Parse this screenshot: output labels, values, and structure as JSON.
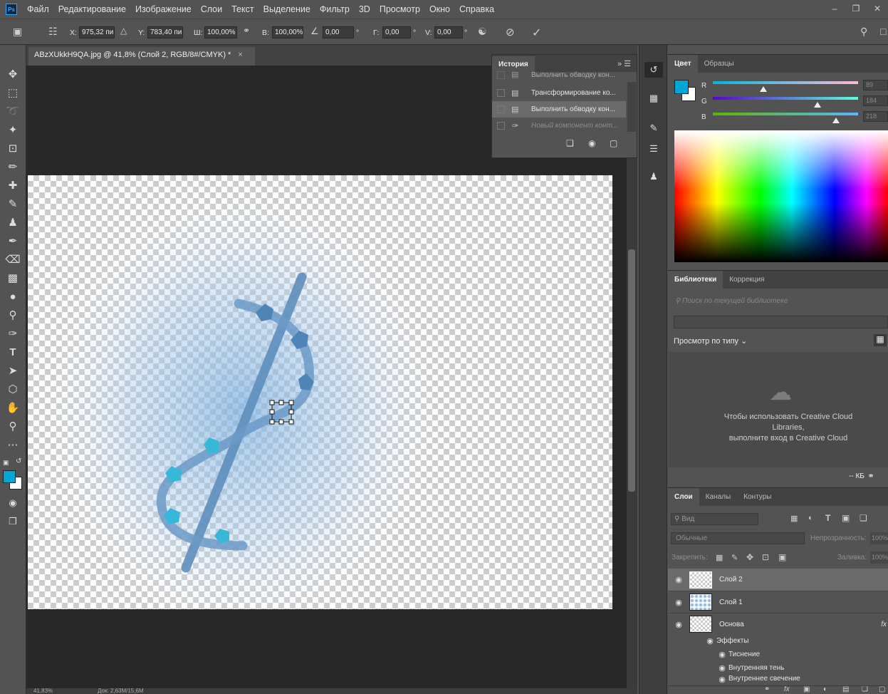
{
  "app": {
    "logo_text": "Ps"
  },
  "menu": [
    "Файл",
    "Редактирование",
    "Изображение",
    "Слои",
    "Текст",
    "Выделение",
    "Фильтр",
    "3D",
    "Просмотр",
    "Окно",
    "Справка"
  ],
  "options": {
    "x_label": "X:",
    "x_value": "975,32 пи",
    "y_label": "Y:",
    "y_value": "783,40 пи",
    "w_label": "Ш:",
    "w_value": "100,00%",
    "h_label": "В:",
    "h_value": "100,00%",
    "angle_value": "0,00",
    "deg": "°",
    "hskew_label": "Г:",
    "hskew_value": "0,00",
    "vskew_label": "V:",
    "vskew_value": "0,00"
  },
  "document": {
    "tab_title": "ABzXUkkH9QA.jpg @ 41,8% (Слой 2, RGB/8#/CMYK) *",
    "close": "×",
    "status_zoom": "41,83%",
    "status_doc": "Док: 2,63M/15,6M"
  },
  "history": {
    "tab": "История",
    "items": [
      {
        "label": "Выполнить обводку кон...",
        "state": "partial"
      },
      {
        "label": "Трансформирование ко...",
        "state": "normal"
      },
      {
        "label": "Выполнить обводку кон...",
        "state": "selected"
      },
      {
        "label": "Новый компонент конт...",
        "state": "disabled"
      }
    ]
  },
  "color_panel": {
    "tabs": [
      "Цвет",
      "Образцы"
    ],
    "fg_color": "#00a6d6",
    "bg_color": "#ffffff",
    "channels": [
      {
        "label": "R",
        "value": "89",
        "fraction": 0.35
      },
      {
        "label": "G",
        "value": "184",
        "fraction": 0.72
      },
      {
        "label": "B",
        "value": "218",
        "fraction": 0.85
      }
    ]
  },
  "libraries": {
    "tabs": [
      "Библиотеки",
      "Коррекция"
    ],
    "search_placeholder": "Поиск по текущей библиотеке",
    "view_by": "Просмотр по типу",
    "message_line1": "Чтобы использовать Creative Cloud",
    "message_line2": "Libraries,",
    "message_line3": "выполните вход в Creative Cloud",
    "size": "-- КБ"
  },
  "layers": {
    "tabs": [
      "Слои",
      "Каналы",
      "Контуры"
    ],
    "filter_placeholder": "Вид",
    "blend_mode": "Обычные",
    "opacity_label": "Непрозрачность:",
    "opacity_value": "100%",
    "lock_label": "Закрепить:",
    "fill_label": "Заливка:",
    "fill_value": "100%",
    "items": [
      {
        "name": "Слой 2",
        "selected": true
      },
      {
        "name": "Слой 1",
        "selected": false
      },
      {
        "name": "Основа",
        "selected": false,
        "fx": "fx"
      }
    ],
    "effects_label": "Эффекты",
    "effects": [
      "Тиснение",
      "Внутренняя тень",
      "Внутреннее свечение"
    ]
  }
}
